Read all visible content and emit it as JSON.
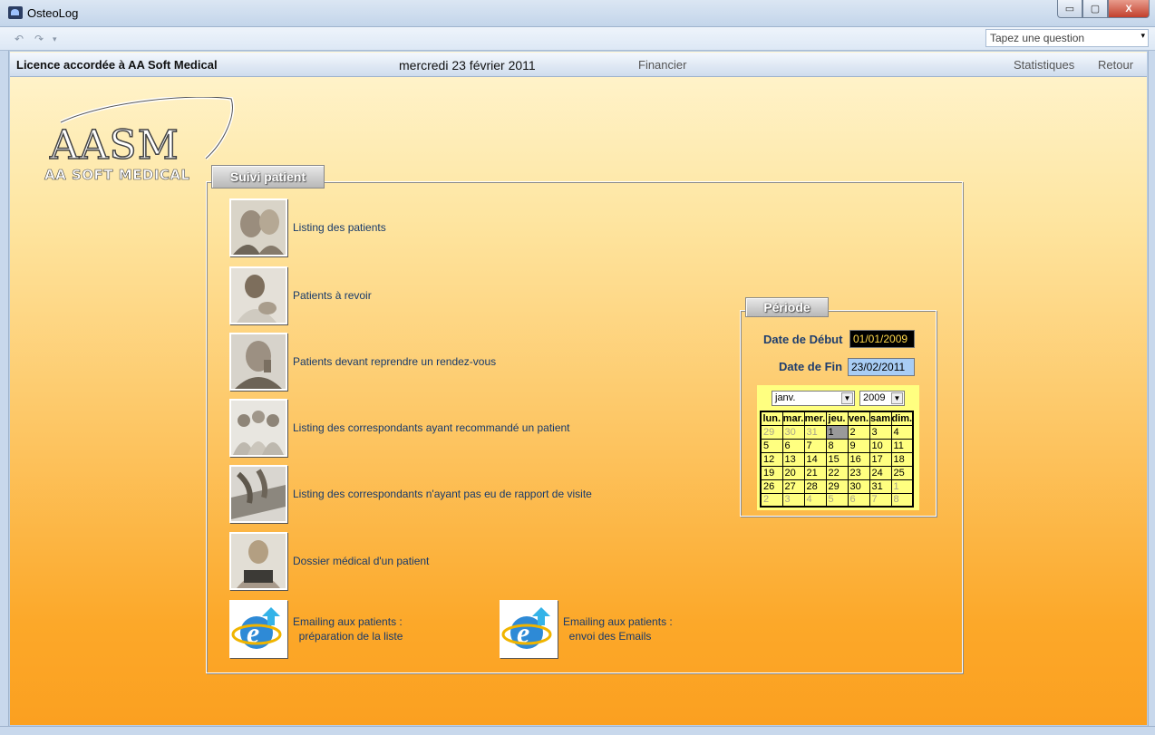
{
  "window": {
    "title": "OsteoLog",
    "minimize": "▭",
    "maximize": "▢",
    "close": "X"
  },
  "toolbar": {
    "undo_icon": "↶",
    "redo_icon": "↷",
    "dropdown_icon": "▾",
    "question_placeholder": "Tapez une question",
    "question_arrow": "▾"
  },
  "header": {
    "license": "Licence accordée à  AA Soft Medical",
    "date": "mercredi 23 février 2011",
    "financier": "Financier",
    "statistiques": "Statistiques",
    "retour": "Retour"
  },
  "logo": {
    "main": "AASM",
    "sub": "AA SOFT MEDICAL"
  },
  "suivi": {
    "tab": "Suivi patient",
    "items": [
      {
        "label": "Listing des patients",
        "icon": "patients-photo-icon"
      },
      {
        "label": "Patients à revoir",
        "icon": "nurse-baby-photo-icon"
      },
      {
        "label": "Patients devant reprendre un rendez-vous",
        "icon": "elderly-man-photo-icon"
      },
      {
        "label": "Listing des correspondants ayant recommandé un patient",
        "icon": "medical-team-photo-icon"
      },
      {
        "label": "Listing des correspondants n'ayant pas eu de rapport de visite",
        "icon": "keyboard-photo-icon"
      },
      {
        "label": "Dossier médical d'un patient",
        "icon": "woman-laptop-photo-icon"
      }
    ],
    "emailing": [
      {
        "line1": "Emailing aux patients :",
        "line2": "préparation de la liste",
        "icon": "internet-explorer-icon"
      },
      {
        "line1": "Emailing aux patients :",
        "line2": "envoi des Emails",
        "icon": "internet-explorer-icon"
      }
    ]
  },
  "periode": {
    "tab": "Période",
    "start_label": "Date de Début",
    "start_value": "01/01/2009",
    "end_label": "Date de Fin",
    "end_value": "23/02/2011",
    "month": "janv.",
    "year": "2009",
    "days_header": [
      "lun.",
      "mar.",
      "mer.",
      "jeu.",
      "ven.",
      "sam",
      "dim."
    ],
    "weeks": [
      [
        "29",
        "30",
        "31",
        "1",
        "2",
        "3",
        "4"
      ],
      [
        "5",
        "6",
        "7",
        "8",
        "9",
        "10",
        "11"
      ],
      [
        "12",
        "13",
        "14",
        "15",
        "16",
        "17",
        "18"
      ],
      [
        "19",
        "20",
        "21",
        "22",
        "23",
        "24",
        "25"
      ],
      [
        "26",
        "27",
        "28",
        "29",
        "30",
        "31",
        "1"
      ],
      [
        "2",
        "3",
        "4",
        "5",
        "6",
        "7",
        "8"
      ]
    ],
    "colors": {
      "calendar_bg": "#ffff80",
      "start_bg": "#000000",
      "start_fg": "#ffd84a",
      "end_bg": "#a8cdf5"
    }
  }
}
